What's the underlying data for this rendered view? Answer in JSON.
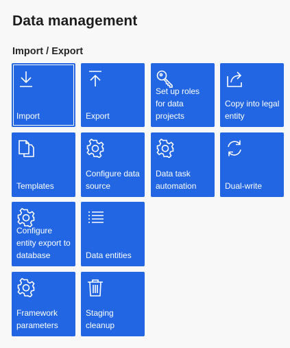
{
  "page": {
    "title": "Data management",
    "section_title": "Import / Export"
  },
  "tiles": {
    "import": {
      "label": "Import",
      "icon": "import-icon"
    },
    "export": {
      "label": "Export",
      "icon": "export-icon"
    },
    "setup_roles": {
      "label": "Set up roles for data projects",
      "icon": "key-icon"
    },
    "copy_legal": {
      "label": "Copy into legal entity",
      "icon": "share-icon"
    },
    "templates": {
      "label": "Templates",
      "icon": "documents-icon"
    },
    "configure_source": {
      "label": "Configure data source",
      "icon": "gear-icon"
    },
    "task_automation": {
      "label": "Data task automation",
      "icon": "gear-icon"
    },
    "dual_write": {
      "label": "Dual-write",
      "icon": "sync-icon"
    },
    "configure_export_db": {
      "label": "Configure entity export to database",
      "icon": "gear-icon"
    },
    "data_entities": {
      "label": "Data entities",
      "icon": "list-icon"
    },
    "framework_params": {
      "label": "Framework parameters",
      "icon": "gear-icon"
    },
    "staging_cleanup": {
      "label": "Staging cleanup",
      "icon": "trash-icon"
    }
  },
  "colors": {
    "tile": "#2266e3",
    "background": "#f8f8f8",
    "text": "#1d1d1d"
  }
}
